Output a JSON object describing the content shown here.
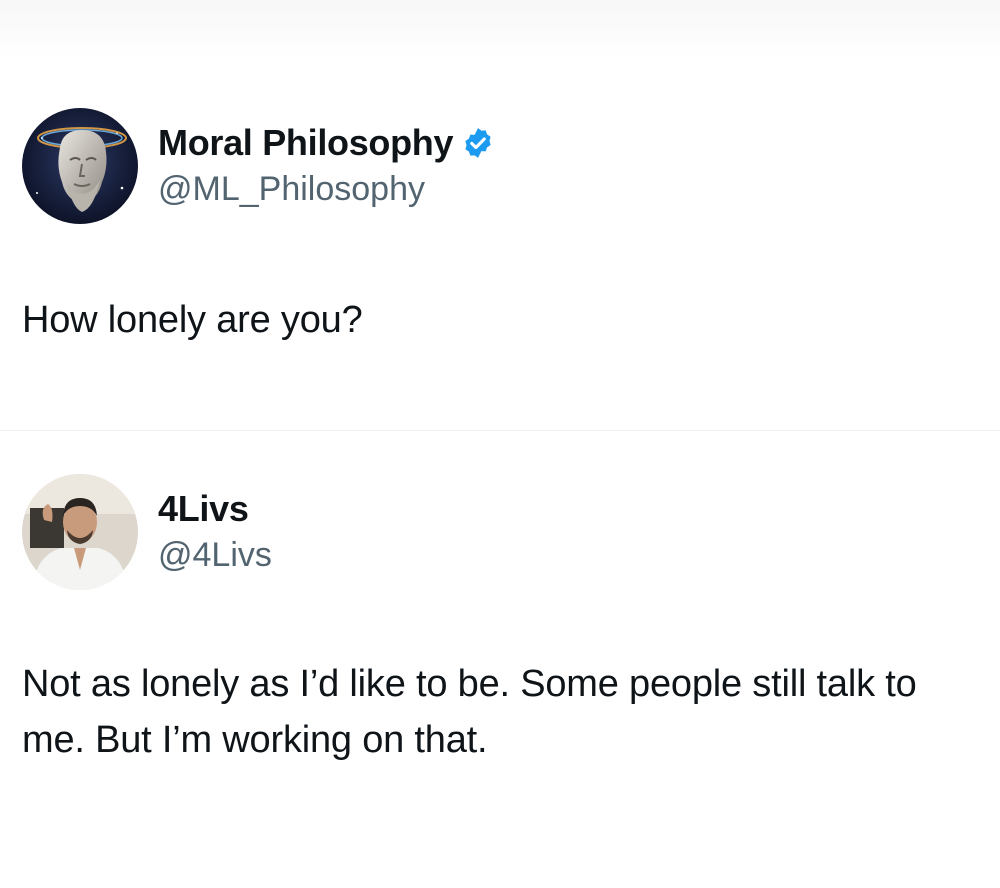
{
  "tweet1": {
    "display_name": "Moral Philosophy",
    "handle": "@ML_Philosophy",
    "verified": true,
    "text": "How lonely are you?"
  },
  "tweet2": {
    "display_name": "4Livs",
    "handle": "@4Livs",
    "verified": false,
    "text": "Not as lonely as I’d like to be. Some people still talk to me. But I’m working on that."
  },
  "colors": {
    "text": "#0f1419",
    "handle": "#536471",
    "verified": "#1d9bf0",
    "background": "#ffffff"
  },
  "icons": {
    "verified": "verified-badge-icon"
  }
}
